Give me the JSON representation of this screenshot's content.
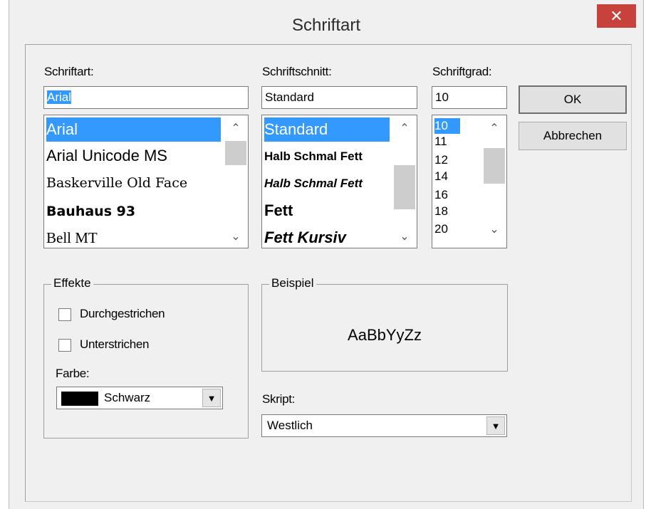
{
  "window": {
    "title": "Schriftart",
    "close_glyph": "✕"
  },
  "font": {
    "label": "Schriftart:",
    "value": "Arial",
    "items": [
      "Arial",
      "Arial Unicode MS",
      "Baskerville Old Face",
      "Bauhaus 93",
      "Bell MT"
    ],
    "selected": "Arial"
  },
  "style": {
    "label": "Schriftschnitt:",
    "value": "Standard",
    "items": [
      "Standard",
      "Halb Schmal Fett",
      "Halb Schmal Fett",
      "Fett",
      "Fett Kursiv"
    ],
    "selected": "Standard"
  },
  "size": {
    "label": "Schriftgrad:",
    "value": "10",
    "items": [
      "10",
      "11",
      "12",
      "14",
      "16",
      "18",
      "20"
    ],
    "selected": "10"
  },
  "buttons": {
    "ok": "OK",
    "cancel": "Abbrechen"
  },
  "effects": {
    "title": "Effekte",
    "strikethrough": {
      "label": "Durchgestrichen",
      "checked": false
    },
    "underline": {
      "label": "Unterstrichen",
      "checked": false
    },
    "color_label": "Farbe:",
    "color_value": "Schwarz",
    "color_hex": "#000000"
  },
  "sample": {
    "title": "Beispiel",
    "text": "AaBbYyZz"
  },
  "script": {
    "label": "Skript:",
    "value": "Westlich"
  },
  "icons": {
    "scroll_up": "chevron-up-icon",
    "scroll_down": "chevron-down-icon",
    "dropdown": "triangle-down-icon"
  },
  "colors": {
    "selection": "#3399ff",
    "close": "#c7423a"
  }
}
